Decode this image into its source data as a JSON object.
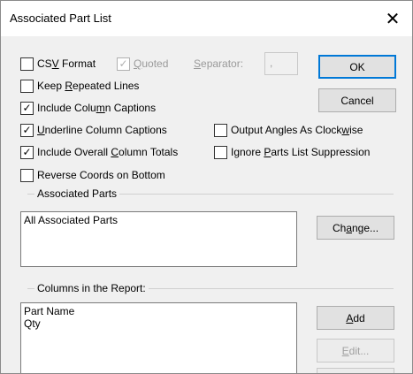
{
  "window": {
    "title": "Associated Part List",
    "close_glyph": "✕"
  },
  "options": {
    "csv_format": {
      "label_pre": "CS",
      "label_u": "V",
      "label_post": " Format",
      "checked": false
    },
    "quoted": {
      "label_pre": "",
      "label_u": "Q",
      "label_post": "uoted",
      "checked": true,
      "disabled": true
    },
    "separator": {
      "label_pre": "",
      "label_u": "S",
      "label_post": "eparator:",
      "value": ",",
      "disabled": true
    },
    "keep_repeated": {
      "label_pre": "Keep ",
      "label_u": "R",
      "label_post": "epeated Lines",
      "checked": false
    },
    "include_captions": {
      "label_pre": "Include Colu",
      "label_u": "m",
      "label_post": "n Captions",
      "checked": true
    },
    "underline_captions": {
      "label_pre": "",
      "label_u": "U",
      "label_post": "nderline Column Captions",
      "checked": true
    },
    "output_angles": {
      "label_pre": "Output Angles As Clock",
      "label_u": "w",
      "label_post": "ise",
      "checked": false
    },
    "overall_totals": {
      "label_pre": "Include Overall ",
      "label_u": "C",
      "label_post": "olumn Totals",
      "checked": true
    },
    "ignore_suppression": {
      "label_pre": "Ignore ",
      "label_u": "P",
      "label_post": "arts List Suppression",
      "checked": false
    },
    "reverse_coords": {
      "label_pre": "Reverse Coords on Bottom",
      "label_u": "",
      "label_post": "",
      "checked": false
    }
  },
  "buttons": {
    "ok": "OK",
    "cancel": "Cancel",
    "change": {
      "pre": "Ch",
      "u": "a",
      "post": "nge..."
    },
    "add": {
      "pre": "",
      "u": "A",
      "post": "dd"
    },
    "edit": {
      "pre": "",
      "u": "E",
      "post": "dit..."
    }
  },
  "associated_parts": {
    "group_label": "Associated Parts",
    "items": [
      "All Associated Parts"
    ]
  },
  "columns": {
    "group_label": "Columns in the Report:",
    "items": [
      "Part Name",
      "Qty"
    ]
  }
}
